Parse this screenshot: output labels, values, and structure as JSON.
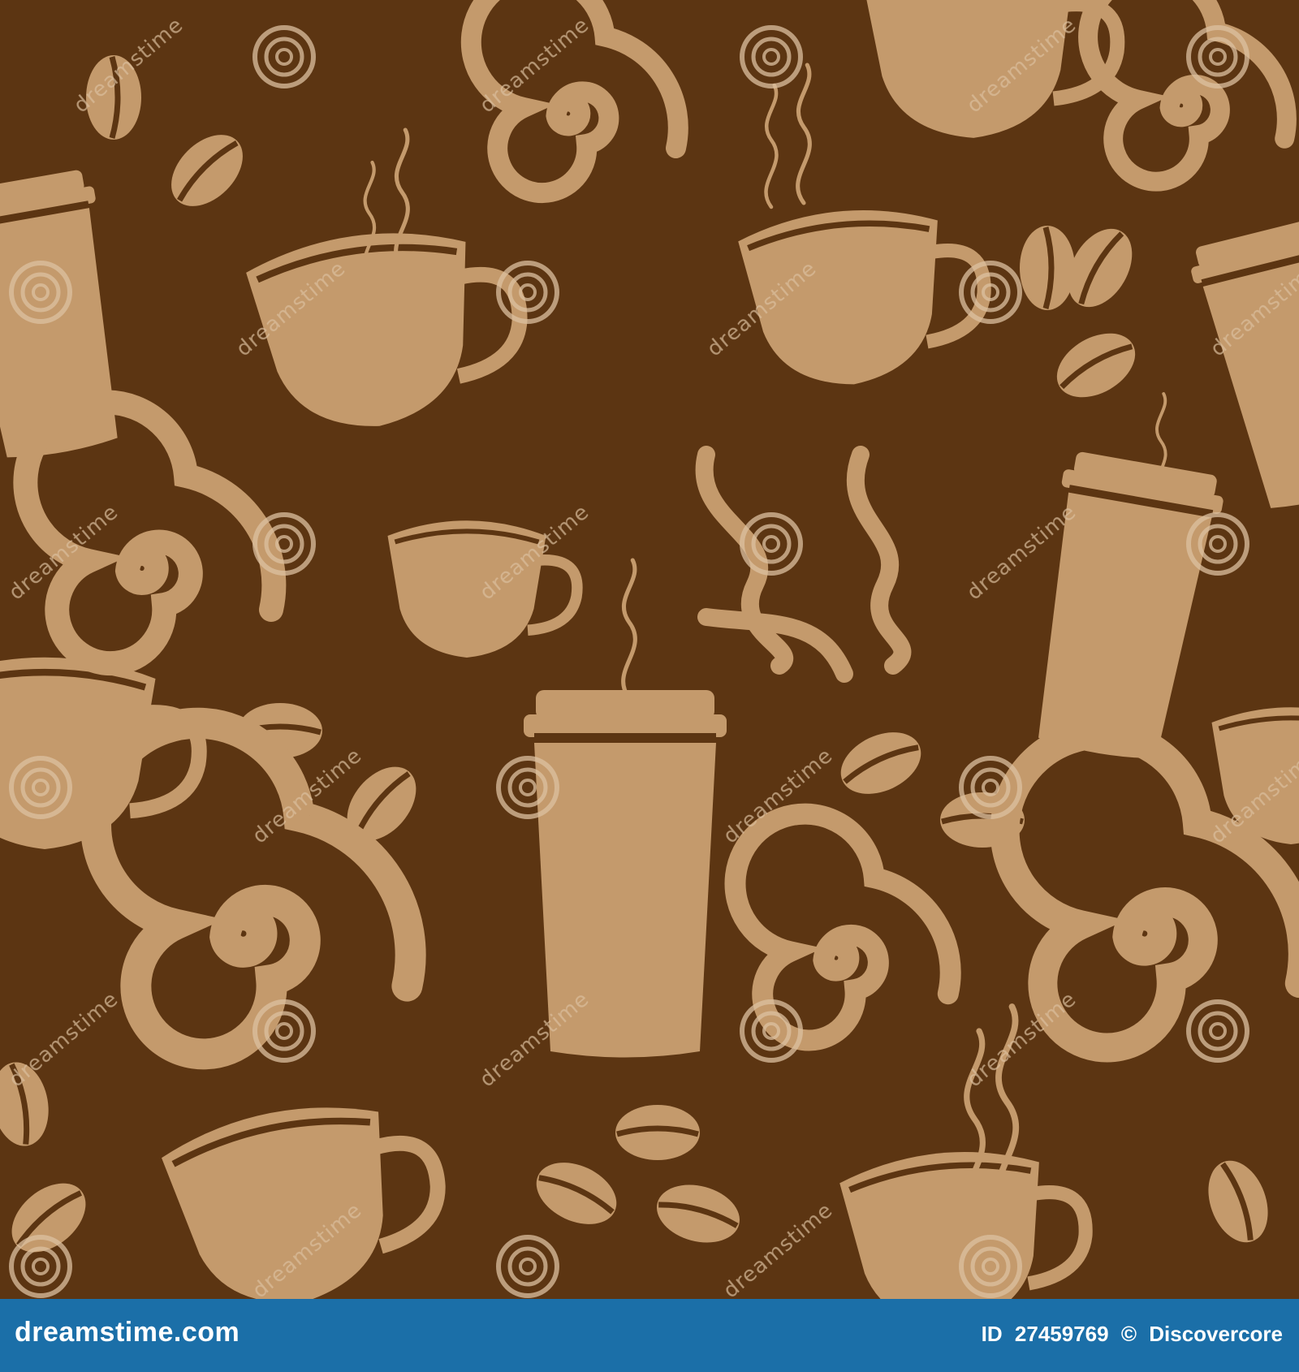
{
  "colors": {
    "background": "#5c3512",
    "motif": "#c49a6c",
    "watermark": "#dcc0a0",
    "footer": "#1b6fa8"
  },
  "icons": [
    "coffee-cup-icon",
    "takeaway-cup-icon",
    "coffee-bean-icon",
    "swirl-icon",
    "steam-icon",
    "watermark-spiral-icon"
  ],
  "watermark": {
    "text": "dreamstime"
  },
  "footer": {
    "site": "dreamstime.com",
    "id_label": "ID",
    "id_value": "27459769",
    "copyright": "©",
    "author": "Discovercore"
  }
}
